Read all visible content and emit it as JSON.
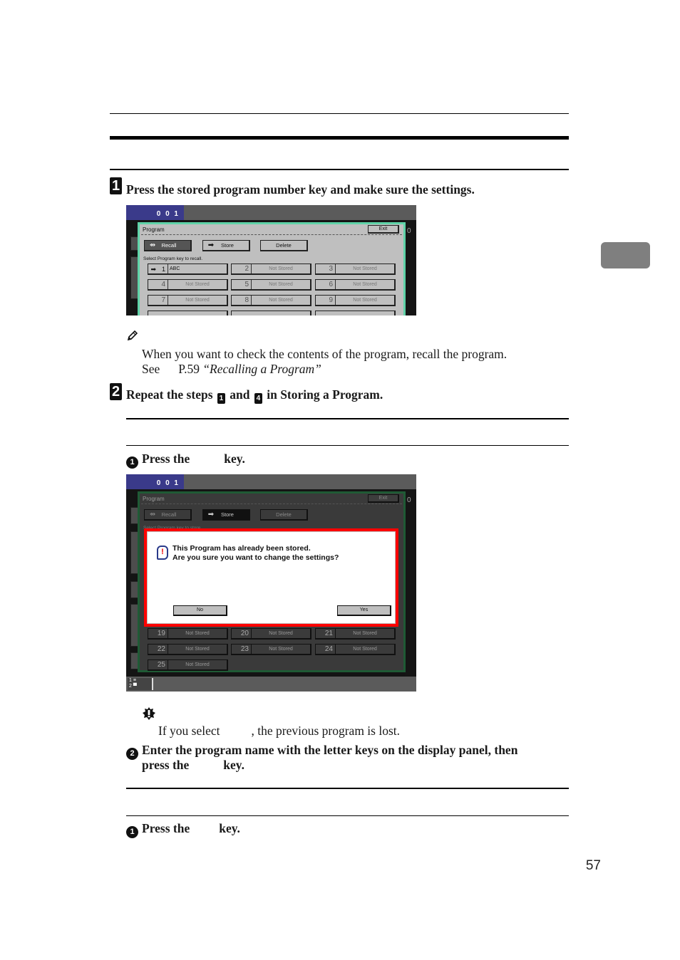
{
  "page": {
    "number": "57"
  },
  "steps": [
    {
      "badge": "1",
      "heading": "Press the stored program number key and make sure the settings."
    },
    {
      "badge": "2",
      "heading_prefix": "Repeat the steps",
      "ref_a": "1",
      "heading_mid": "and",
      "ref_b": "4",
      "heading_suffix": "in Storing a Program."
    }
  ],
  "note": {
    "icon": "pencil-icon",
    "line1": "When you want to check the contents of the program, recall the program.",
    "see_label": "See",
    "page_ref": "P.59",
    "link_title": "“Recalling a Program”"
  },
  "substeps_a": [
    {
      "num": "1",
      "text_before": "Press the",
      "text_after": "key."
    }
  ],
  "important": {
    "icon": "important-icon",
    "text_before": "If you select",
    "text_after": ", the previous program is lost."
  },
  "substep_a2": {
    "num": "2",
    "line1": "Enter the program name with the letter keys on the display panel, then",
    "line2_before": "press the",
    "line2_after": "key."
  },
  "substeps_b": [
    {
      "num": "1",
      "text_before": "Press the",
      "text_after": "key."
    }
  ],
  "screen1": {
    "counter": "0 0 1",
    "dialog_title": "Program",
    "exit_label": "Exit",
    "modes": [
      {
        "label": "Recall",
        "icon": "recall-arrow-icon",
        "active": true
      },
      {
        "label": "Store",
        "icon": "store-arrow-icon",
        "active": false
      },
      {
        "label": "Delete",
        "icon": "",
        "active": false
      }
    ],
    "instruction": "Select Program key to recall.",
    "programs": [
      {
        "num": "1",
        "name": "ABC",
        "stored": true
      },
      {
        "num": "2",
        "name": "Not Stored"
      },
      {
        "num": "3",
        "name": "Not Stored"
      },
      {
        "num": "4",
        "name": "Not Stored"
      },
      {
        "num": "5",
        "name": "Not Stored"
      },
      {
        "num": "6",
        "name": "Not Stored"
      },
      {
        "num": "7",
        "name": "Not Stored"
      },
      {
        "num": "8",
        "name": "Not Stored"
      },
      {
        "num": "9",
        "name": "Not Stored"
      }
    ],
    "side_zero": "0"
  },
  "screen2": {
    "counter": "0 0 1",
    "dialog_title": "Program",
    "exit_label": "Exit",
    "modes": [
      {
        "label": "Recall",
        "icon": "recall-arrow-icon",
        "active": false
      },
      {
        "label": "Store",
        "icon": "store-arrow-icon",
        "active": true
      },
      {
        "label": "Delete",
        "icon": "",
        "active": false
      }
    ],
    "instruction": "Select Program key to store.",
    "alert": {
      "line1": "This Program has already been stored.",
      "line2": "Are you sure you want to change the settings?",
      "no_label": "No",
      "yes_label": "Yes",
      "accent": "#ff0000"
    },
    "programs": [
      {
        "num": "19",
        "name": "Not Stored"
      },
      {
        "num": "20",
        "name": "Not Stored"
      },
      {
        "num": "21",
        "name": "Not Stored"
      },
      {
        "num": "22",
        "name": "Not Stored"
      },
      {
        "num": "23",
        "name": "Not Stored"
      },
      {
        "num": "24",
        "name": "Not Stored"
      },
      {
        "num": "25",
        "name": "Not Stored"
      }
    ],
    "tray_1": "1",
    "tray_2": "2",
    "side_zero": "0"
  }
}
